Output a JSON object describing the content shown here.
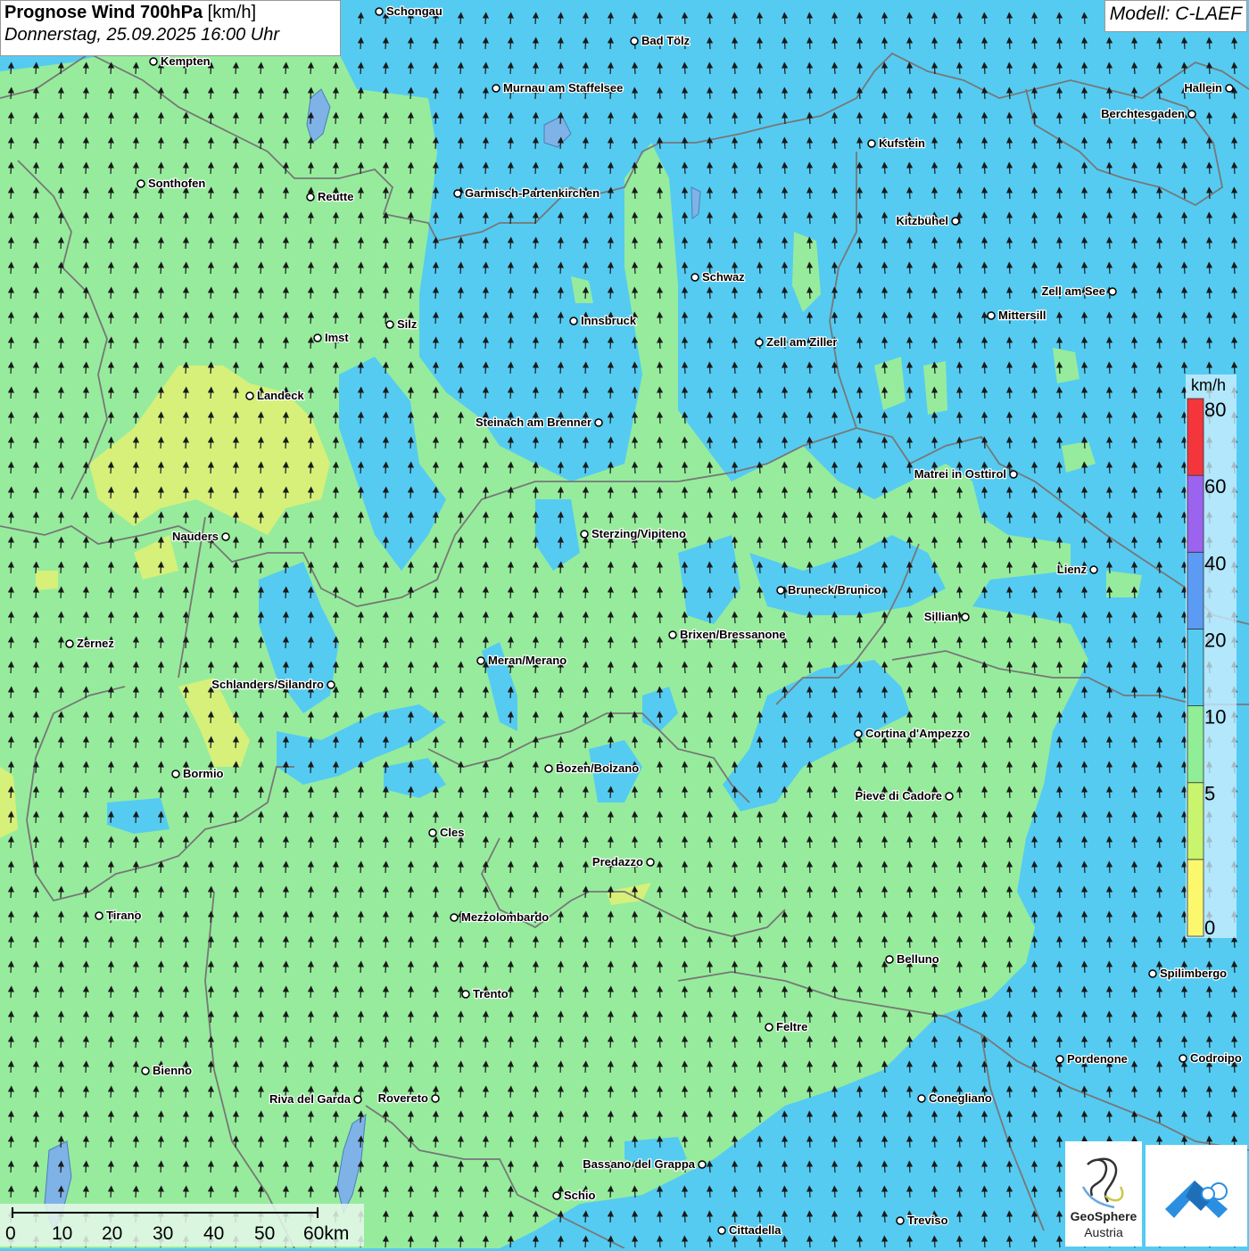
{
  "header": {
    "title_bold": "Prognose Wind 700hPa",
    "title_unit": "[km/h]",
    "subtitle": "Donnerstag, 25.09.2025 16:00 Uhr",
    "model": "Modell: C-LAEF"
  },
  "legend": {
    "unit": "km/h",
    "ticks": [
      "0",
      "5",
      "10",
      "20",
      "40",
      "60",
      "80"
    ],
    "colors": [
      "#fbf86e",
      "#c9f46e",
      "#8fee96",
      "#55cbf2",
      "#5b9bf4",
      "#9b63ee",
      "#f4363c"
    ]
  },
  "map_colors": {
    "weak_wind": "#e8f27a",
    "moderate_wind": "#96ec9c",
    "strong_wind": "#55cbf2",
    "border": "#777777",
    "arrow": "#1a1a1a"
  },
  "cities": [
    "Schongau",
    "Kempten",
    "Bad Tölz",
    "Murnau am Staffelsee",
    "Hallein",
    "Berchtesgaden",
    "Kufstein",
    "Sonthofen",
    "Reutte",
    "Garmisch-Partenkirchen",
    "Kitzbühel",
    "Schwaz",
    "Zell am See",
    "Mittersill",
    "Innsbruck",
    "Silz",
    "Imst",
    "Zell am Ziller",
    "Landeck",
    "Steinach am Brenner",
    "Matrei in Osttirol",
    "Nauders",
    "Sterzing/Vipiteno",
    "Lienz",
    "Bruneck/Brunico",
    "Sillian",
    "Zernez",
    "Brixen/Bressanone",
    "Meran/Merano",
    "Schlanders/Silandro",
    "Cortina d'Ampezzo",
    "Bozen/Bolzano",
    "Bormio",
    "Pieve di Cadore",
    "Cles",
    "Predazzo",
    "Tirano",
    "Mezzolombardo",
    "Belluno",
    "Spilimbergo",
    "Trento",
    "Feltre",
    "Pordenone",
    "Codroipo",
    "Bienno",
    "Riva del Garda",
    "Rovereto",
    "Conegliano",
    "Bassano del Grappa",
    "Schio",
    "Treviso",
    "Cittadella"
  ],
  "scale": {
    "labels": [
      "0",
      "10",
      "20",
      "30",
      "40",
      "50",
      "60km"
    ]
  },
  "logos": {
    "geosphere_line1": "GeoSphere",
    "geosphere_line2": "Austria"
  }
}
